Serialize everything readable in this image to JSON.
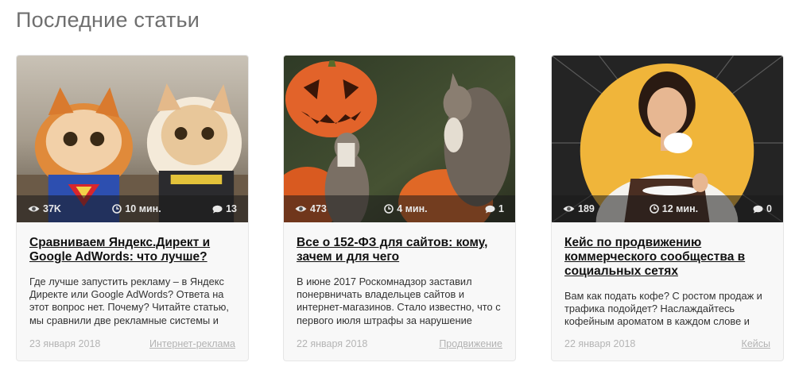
{
  "section": {
    "title": "Последние статьи"
  },
  "colors": {
    "accent_yellow": "#f0b53a",
    "meta_text": "#e9e9e9",
    "muted": "#b5b5b5"
  },
  "articles": [
    {
      "image": "cats-in-superhero-costumes",
      "views": "37K",
      "read_time": "10 мин.",
      "comments": "13",
      "title": "Сравниваем Яндекс.Директ и Google AdWords: что лучше?",
      "description": "Где лучше запустить рекламу – в Яндекс Директе или Google AdWords? Ответа на этот вопрос нет. Почему? Читайте статью, мы сравнили две рекламные системы и",
      "date": "23 января 2018",
      "category": "Интернет-реклама"
    },
    {
      "image": "squirrels-with-pumpkins",
      "views": "473",
      "read_time": "4 мин.",
      "comments": "1",
      "title": "Все о 152-ФЗ для сайтов: кому, зачем и для чего",
      "description": "В июне 2017 Роскомнадзор заставил понервничать владельцев сайтов и интернет-магазинов. Стало известно, что с первого июля штрафы за нарушение",
      "date": "22 января 2018",
      "category": "Продвижение"
    },
    {
      "image": "woman-with-coffee-cup",
      "views": "189",
      "read_time": "12 мин.",
      "comments": "0",
      "title": "Кейс по продвижению коммерческого сообщества в социальных сетях",
      "description": "Вам как подать кофе? С ростом продаж и трафика подойдет? Наслаждайтесь кофейным ароматом в каждом слове и",
      "date": "22 января 2018",
      "category": "Кейсы"
    }
  ]
}
